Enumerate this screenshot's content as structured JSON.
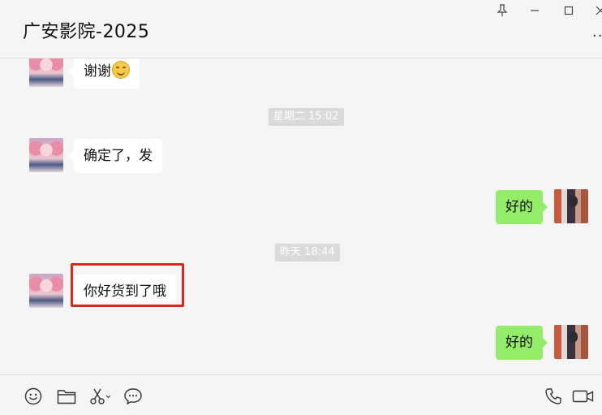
{
  "header": {
    "title": "广安影院-2025",
    "more_label": "··"
  },
  "window_controls": {
    "pin_icon": "pin-icon",
    "minimize_icon": "minimize-icon",
    "maximize_icon": "maximize-icon",
    "close_icon": "close-icon"
  },
  "messages": [
    {
      "type": "message",
      "direction": "in",
      "text": "谢谢",
      "emoji": "smiling-face"
    },
    {
      "type": "timestamp",
      "text": "星期二 15:02"
    },
    {
      "type": "message",
      "direction": "in",
      "text": "确定了，发"
    },
    {
      "type": "message",
      "direction": "out",
      "text": "好的"
    },
    {
      "type": "timestamp",
      "text": "昨天 18:44"
    },
    {
      "type": "message",
      "direction": "in",
      "text": "你好货到了哦",
      "highlighted": true
    },
    {
      "type": "message",
      "direction": "out",
      "text": "好的"
    }
  ],
  "toolbar": {
    "left_tools": [
      "emoji-icon",
      "folder-icon",
      "scissors-icon",
      "chat-history-icon"
    ],
    "right_tools": [
      "phone-icon",
      "video-call-icon"
    ]
  },
  "colors": {
    "background": "#f5f5f5",
    "incoming_bubble": "#ffffff",
    "outgoing_bubble": "#95ec69",
    "timestamp_bg": "#dadada",
    "highlight": "#d42a22"
  }
}
